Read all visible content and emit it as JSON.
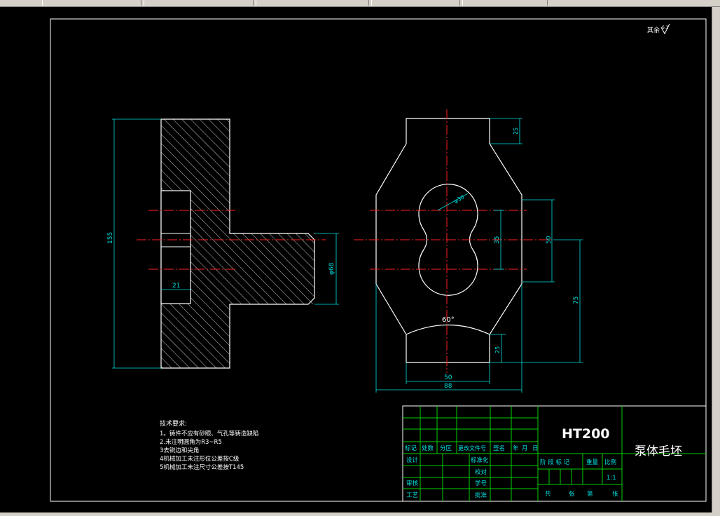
{
  "material": "HT200",
  "part_title": "泵体毛坯",
  "surface_roughness_note": "其余",
  "roughness_symbol_value": "6.3",
  "technical_requirements": {
    "heading": "技术要求:",
    "items": [
      "1。铸件不应有砂眼、气孔等铸造缺陷",
      "2.未注明圆角为R3~R5",
      "3去锐边和尖角",
      "4机械加工未注形位公差按C级",
      "5机械加工未注尺寸公差按T145"
    ]
  },
  "dimensions": {
    "left_view_height": "155",
    "left_view_diameter": "φ68",
    "left_view_depth": "21",
    "front_top_step": "25",
    "front_bottom_step": "25",
    "front_bore_spacing": "35",
    "front_right_50": "50",
    "front_right_75": "75",
    "front_bottom_width_inner": "50",
    "front_bottom_width_outer": "88",
    "front_bore_diameter": "φ30",
    "front_arc_angle": "60°"
  },
  "title_block": {
    "row_labels": [
      "标记",
      "处数",
      "分区",
      "更改文件号",
      "签名",
      "年",
      "月",
      "日"
    ],
    "design": "设计",
    "standardize": "标准化",
    "check": "审核",
    "process": "工艺",
    "review": "校对",
    "number": "学号",
    "approve": "批准",
    "stage": "阶 段 标 记",
    "weight": "重量",
    "scale_label": "比例",
    "scale_value": "1:1",
    "sheet_total": "共",
    "sheet_unit_1": "张",
    "sheet_current": "第",
    "sheet_unit_2": "张"
  },
  "colors": {
    "background": "#000000",
    "outline": "#ffffff",
    "center_line": "#ff2020",
    "dimension": "#00e0e0",
    "title_block_grid": "#00d000",
    "hatch": "#ffffff"
  }
}
